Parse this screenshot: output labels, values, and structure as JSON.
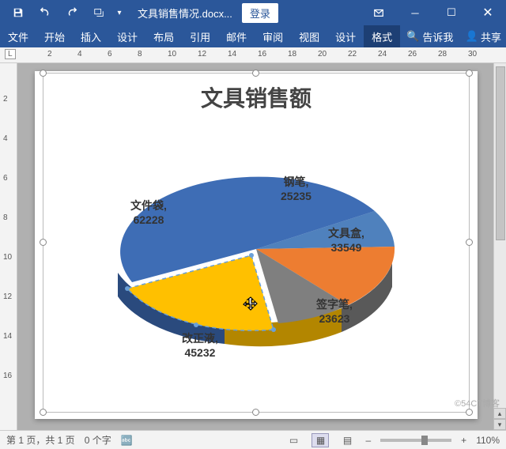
{
  "titlebar": {
    "doc_name": "文具销售情况.docx...",
    "login": "登录"
  },
  "ribbon": {
    "tabs": [
      "文件",
      "开始",
      "插入",
      "设计",
      "布局",
      "引用",
      "邮件",
      "审阅",
      "视图",
      "设计",
      "格式"
    ],
    "active_index": 10,
    "tellme": "告诉我",
    "share": "共享"
  },
  "ruler_h": [
    2,
    4,
    6,
    8,
    10,
    12,
    14,
    16,
    18,
    20,
    22,
    24,
    26,
    28,
    30
  ],
  "ruler_v": [
    2,
    4,
    6,
    8,
    10,
    12,
    14,
    16
  ],
  "chart_data": {
    "type": "pie",
    "title": "文具销售额",
    "series": [
      {
        "name": "钢笔",
        "value": 25235,
        "color": "#4f81bd"
      },
      {
        "name": "文具盒",
        "value": 33549,
        "color": "#ed7d31"
      },
      {
        "name": "签字笔",
        "value": 23623,
        "color": "#7f7f7f"
      },
      {
        "name": "改正液",
        "value": 45232,
        "color": "#ffc000"
      },
      {
        "name": "文件袋",
        "value": 62228,
        "color": "#3e6db5"
      }
    ],
    "selected_slice": "改正液",
    "style": "3d-exploded"
  },
  "labels": {
    "pen": "钢笔, 25235",
    "box": "文具盒, 33549",
    "sign": "签字笔, 23623",
    "corr": "改正液, 45232",
    "folder": "文件袋, 62228"
  },
  "status": {
    "page": "第 1 页，共 1 页",
    "words": "0 个字",
    "zoom": "110%"
  },
  "watermark": "©54CT博客"
}
